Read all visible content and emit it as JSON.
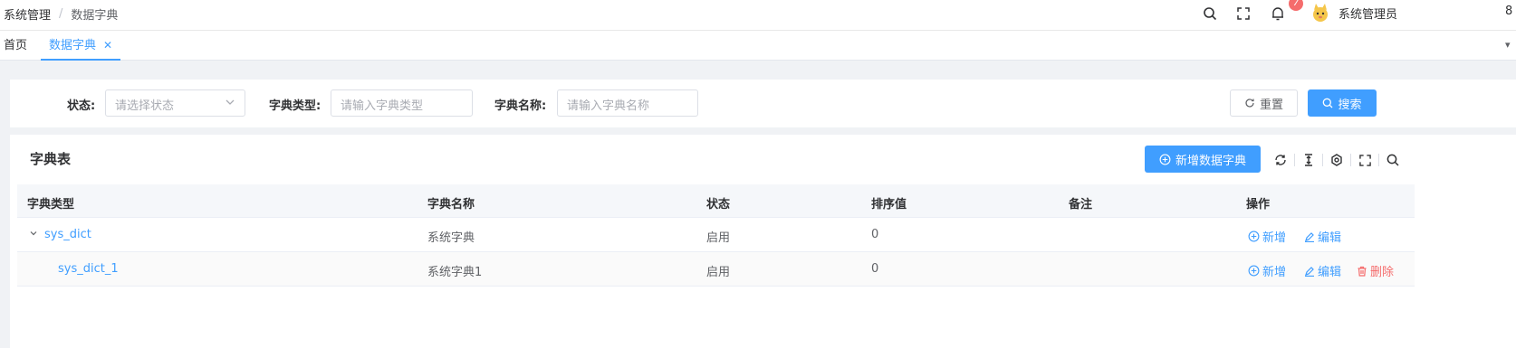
{
  "breadcrumb": {
    "root": "系统管理",
    "separator": "/",
    "current": "数据字典"
  },
  "header": {
    "notification_count": "7",
    "username": "系统管理员",
    "right_clip": "8"
  },
  "tabs": {
    "home": "首页",
    "active": "数据字典",
    "close_glyph": "✕"
  },
  "filter": {
    "status_label": "状态:",
    "status_placeholder": "请选择状态",
    "type_label": "字典类型:",
    "type_placeholder": "请输入字典类型",
    "name_label": "字典名称:",
    "name_placeholder": "请输入字典名称",
    "reset_label": "重置",
    "search_label": "搜索"
  },
  "panel": {
    "title": "字典表",
    "add_label": "新增数据字典"
  },
  "table": {
    "headers": [
      "字典类型",
      "字典名称",
      "状态",
      "排序值",
      "备注",
      "操作"
    ],
    "rows": [
      {
        "type": "sys_dict",
        "name": "系统字典",
        "status": "启用",
        "sort": "0",
        "remark": "",
        "add": "新增",
        "edit": "编辑"
      },
      {
        "type": "sys_dict_1",
        "name": "系统字典1",
        "status": "启用",
        "sort": "0",
        "remark": "",
        "add": "新增",
        "edit": "编辑",
        "delete": "删除"
      }
    ]
  },
  "colors": {
    "primary": "#409eff",
    "danger": "#f56c6c",
    "badge": "#f56c6c"
  },
  "icons": [
    "search-icon",
    "fullscreen-icon",
    "bell-icon",
    "avatar-icon",
    "chevron-down-icon",
    "refresh-icon",
    "column-height-icon",
    "settings-icon",
    "plus-circle-icon",
    "edit-icon",
    "delete-icon"
  ]
}
